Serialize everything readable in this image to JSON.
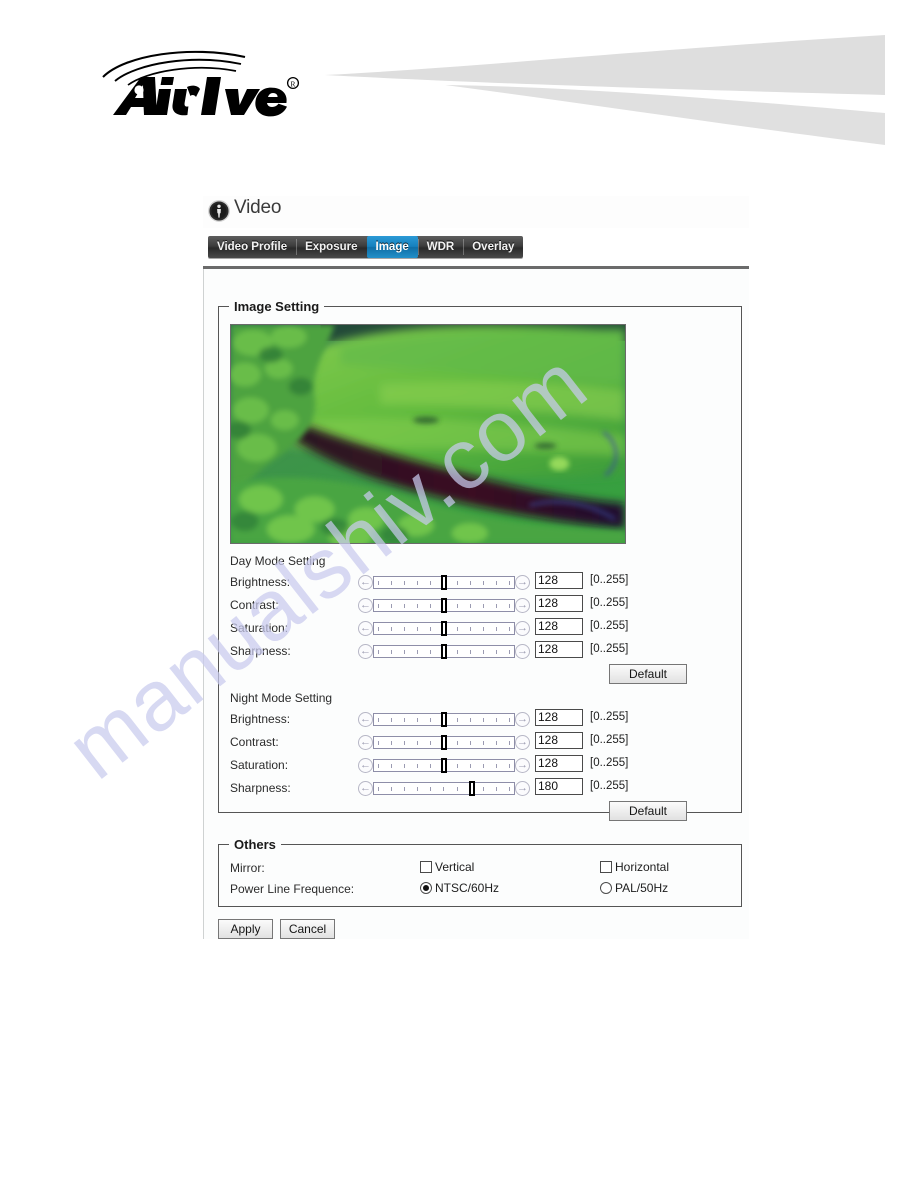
{
  "brand": {
    "logo_text": "Air Live",
    "trademark": "®"
  },
  "page": {
    "title": "Video",
    "icon": "video-camera-icon"
  },
  "tabs": [
    {
      "label": "Video Profile",
      "active": false
    },
    {
      "label": "Exposure",
      "active": false
    },
    {
      "label": "Image",
      "active": true
    },
    {
      "label": "WDR",
      "active": false
    },
    {
      "label": "Overlay",
      "active": false
    }
  ],
  "image_setting": {
    "legend": "Image Setting",
    "preview_alt": "live-camera-preview",
    "day": {
      "heading": "Day Mode Setting",
      "rows": [
        {
          "label": "Brightness:",
          "value": "128",
          "range": "[0..255]",
          "percent": 50
        },
        {
          "label": "Contrast:",
          "value": "128",
          "range": "[0..255]",
          "percent": 50
        },
        {
          "label": "Saturation:",
          "value": "128",
          "range": "[0..255]",
          "percent": 50
        },
        {
          "label": "Sharpness:",
          "value": "128",
          "range": "[0..255]",
          "percent": 50
        }
      ],
      "default_label": "Default"
    },
    "night": {
      "heading": "Night Mode Setting",
      "rows": [
        {
          "label": "Brightness:",
          "value": "128",
          "range": "[0..255]",
          "percent": 50
        },
        {
          "label": "Contrast:",
          "value": "128",
          "range": "[0..255]",
          "percent": 50
        },
        {
          "label": "Saturation:",
          "value": "128",
          "range": "[0..255]",
          "percent": 50
        },
        {
          "label": "Sharpness:",
          "value": "180",
          "range": "[0..255]",
          "percent": 70
        }
      ],
      "default_label": "Default"
    }
  },
  "others": {
    "legend": "Others",
    "mirror": {
      "label": "Mirror:",
      "vertical": {
        "label": "Vertical",
        "checked": false
      },
      "horizontal": {
        "label": "Horizontal",
        "checked": false
      }
    },
    "power_line": {
      "label": "Power Line Frequence:",
      "ntsc": {
        "label": "NTSC/60Hz",
        "checked": true
      },
      "pal": {
        "label": "PAL/50Hz",
        "checked": false
      }
    }
  },
  "actions": {
    "apply_label": "Apply",
    "cancel_label": "Cancel"
  },
  "watermark": {
    "text": "manualshiv.com"
  },
  "colors": {
    "tab_active": "#1580bd",
    "tab_bar": "#3d3d3d",
    "banner_swoosh": "#dcdcdc"
  }
}
